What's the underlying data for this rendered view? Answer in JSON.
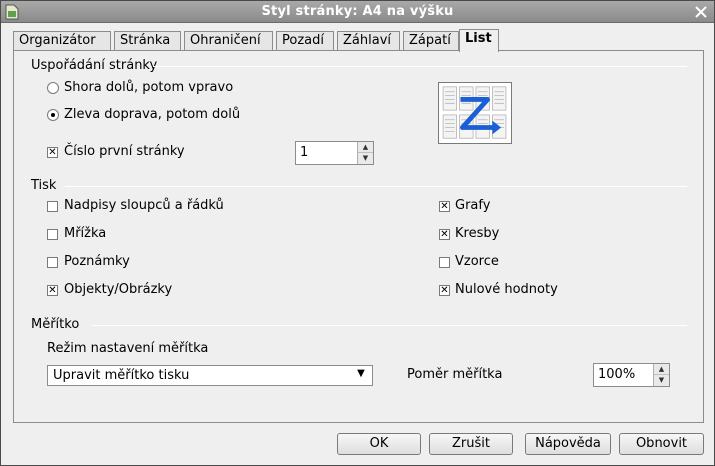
{
  "window": {
    "title": "Styl stránky: A4 na výšku",
    "app_icon": "document-icon",
    "close_icon": "close-icon"
  },
  "tabs": [
    {
      "label": "Organizátor"
    },
    {
      "label": "Stránka"
    },
    {
      "label": "Ohraničení"
    },
    {
      "label": "Pozadí"
    },
    {
      "label": "Záhlaví"
    },
    {
      "label": "Zápatí"
    },
    {
      "label": "List",
      "active": true
    }
  ],
  "page_order": {
    "title": "Uspořádání stránky",
    "option_top_down": "Shora dolů, potom vpravo",
    "option_left_right": "Zleva doprava, potom dolů",
    "selected": "option_left_right",
    "first_page_label": "Číslo první stránky",
    "first_page_checked": true,
    "first_page_value": "1",
    "preview_icon": "page-order-preview-icon"
  },
  "print": {
    "title": "Tisk",
    "left": [
      {
        "label": "Nadpisy sloupců a řádků",
        "checked": false
      },
      {
        "label": "Mřížka",
        "checked": false
      },
      {
        "label": "Poznámky",
        "checked": false
      },
      {
        "label": "Objekty/Obrázky",
        "checked": true
      }
    ],
    "right": [
      {
        "label": "Grafy",
        "checked": true
      },
      {
        "label": "Kresby",
        "checked": true
      },
      {
        "label": "Vzorce",
        "checked": false
      },
      {
        "label": "Nulové hodnoty",
        "checked": true
      }
    ]
  },
  "scale": {
    "title": "Měřítko",
    "mode_label": "Režim nastavení měřítka",
    "mode_value": "Upravit měřítko tisku",
    "ratio_label": "Poměr měřítka",
    "ratio_value": "100%"
  },
  "buttons": {
    "ok": "OK",
    "cancel": "Zrušit",
    "help": "Nápověda",
    "reset": "Obnovit"
  },
  "colors": {
    "titlebar": "#9a9a9a",
    "dialog_bg": "#efefef",
    "preview_arrow": "#1a5fd6"
  }
}
